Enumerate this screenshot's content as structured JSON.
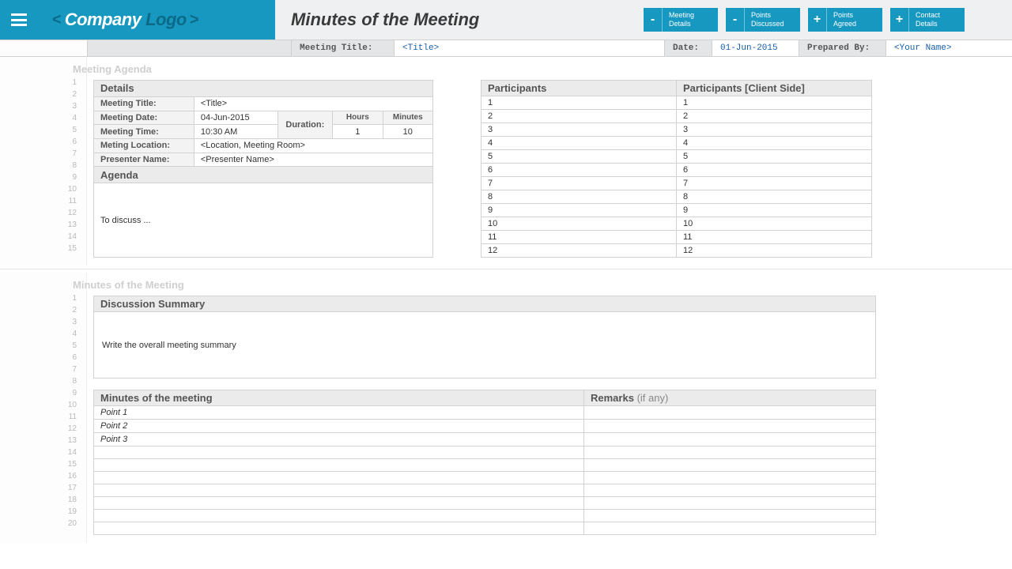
{
  "header": {
    "logo_bracket_left": "<",
    "logo_company": "Company",
    "logo_logo": "Logo",
    "logo_bracket_right": ">",
    "page_title": "Minutes of the Meeting",
    "nav": [
      {
        "sym": "-",
        "line1": "Meeting",
        "line2": "Details"
      },
      {
        "sym": "-",
        "line1": "Points",
        "line2": "Discussed"
      },
      {
        "sym": "+",
        "line1": "Points",
        "line2": "Agreed"
      },
      {
        "sym": "+",
        "line1": "Contact",
        "line2": "Details"
      }
    ]
  },
  "meta": {
    "title_label": "Meeting Title:",
    "title_value": "<Title>",
    "date_label": "Date:",
    "date_value": "01-Jun-2015",
    "prepared_label": "Prepared By:",
    "prepared_value": "<Your Name>"
  },
  "agenda_section": {
    "heading": "Meeting Agenda",
    "rows": [
      "1",
      "2",
      "3",
      "4",
      "5",
      "6",
      "7",
      "8",
      "9",
      "10",
      "11",
      "12",
      "13",
      "14",
      "15"
    ],
    "details": {
      "header": "Details",
      "meeting_title_label": "Meeting Title:",
      "meeting_title_value": "<Title>",
      "meeting_date_label": "Meeting Date:",
      "meeting_date_value": "04-Jun-2015",
      "meeting_time_label": "Meeting Time:",
      "meeting_time_value": "10:30 AM",
      "duration_label": "Duration:",
      "hours_label": "Hours",
      "minutes_label": "Minutes",
      "hours_value": "1",
      "minutes_value": "10",
      "location_label": "Meting Location:",
      "location_value": "<Location, Meeting Room>",
      "presenter_label": "Presenter Name:",
      "presenter_value": "<Presenter Name>",
      "agenda_header": "Agenda",
      "agenda_body": "To discuss ..."
    },
    "participants": {
      "left_header": "Participants",
      "right_header": "Participants [Client Side]",
      "rows": [
        "1",
        "2",
        "3",
        "4",
        "5",
        "6",
        "7",
        "8",
        "9",
        "10",
        "11",
        "12"
      ]
    }
  },
  "minutes_section": {
    "heading": "Minutes of the Meeting",
    "rows": [
      "1",
      "2",
      "3",
      "4",
      "5",
      "6",
      "7",
      "8",
      "9",
      "10",
      "11",
      "12",
      "13",
      "14",
      "15",
      "16",
      "17",
      "18",
      "19",
      "20"
    ],
    "summary_header": "Discussion Summary",
    "summary_body": "Write the overall meeting summary",
    "mom_header": "Minutes of the meeting",
    "remarks_header": "Remarks",
    "remarks_sub": "(if any)",
    "points": [
      "Point 1",
      "Point 2",
      "Point 3",
      "",
      "",
      "",
      "",
      "",
      "",
      ""
    ]
  }
}
